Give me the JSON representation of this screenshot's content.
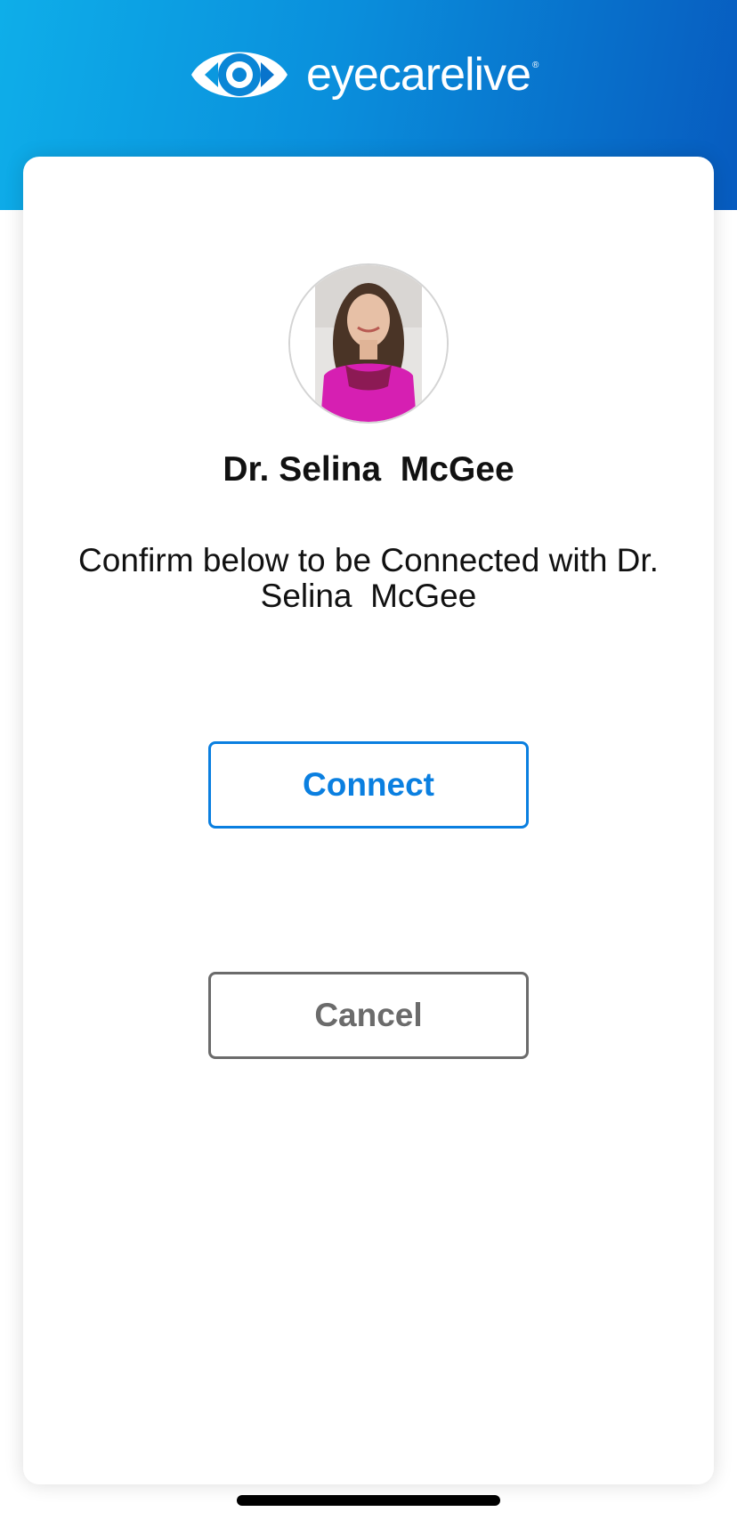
{
  "header": {
    "brand_name": "eyecarelive",
    "brand_mark": "®",
    "logo_icon": "eye-icon",
    "colors": {
      "gradient_start": "#0eaee9",
      "gradient_end": "#075bbf"
    }
  },
  "doctor": {
    "name": "Dr. Selina  McGee",
    "avatar_icon": "doctor-avatar"
  },
  "confirm": {
    "message": "Confirm below to be Connected with Dr.\nSelina  McGee"
  },
  "buttons": {
    "connect_label": "Connect",
    "cancel_label": "Cancel",
    "connect_color": "#0a7fe0",
    "cancel_color": "#6b6b6b"
  }
}
